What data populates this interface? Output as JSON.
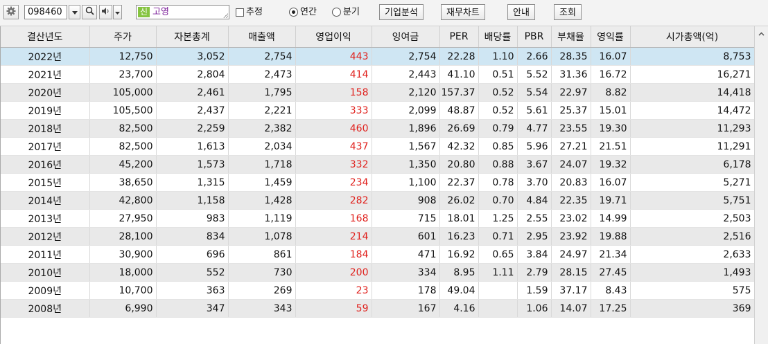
{
  "toolbar": {
    "stock_code": "098460",
    "new_badge": "신",
    "stock_name": "고영",
    "estimate_label": "추정",
    "annual_label": "연간",
    "quarter_label": "분기",
    "buttons": [
      "기업분석",
      "재무차트",
      "안내",
      "조회"
    ]
  },
  "icons": [
    "gear-icon",
    "dropdown-arrow-icon",
    "search-icon",
    "speaker-icon",
    "dropdown-arrow-icon",
    "resize-grip-icon",
    "scroll-up-icon"
  ],
  "colors": {
    "operating_profit": "#e0201c",
    "selected_row": "#cfe6f3",
    "stripe_row": "#e9e9e9",
    "new_badge": "#86c440",
    "stock_name": "#7a1c98"
  },
  "table": {
    "columns": [
      "결산년도",
      "주가",
      "자본총계",
      "매출액",
      "영업이익",
      "잉여금",
      "PER",
      "배당률",
      "PBR",
      "부채율",
      "영익률",
      "시가총액(억)"
    ],
    "rows": [
      [
        "2022년",
        "12,750",
        "3,052",
        "2,754",
        "443",
        "2,754",
        "22.28",
        "1.10",
        "2.66",
        "28.35",
        "16.07",
        "8,753"
      ],
      [
        "2021년",
        "23,700",
        "2,804",
        "2,473",
        "414",
        "2,443",
        "41.10",
        "0.51",
        "5.52",
        "31.36",
        "16.72",
        "16,271"
      ],
      [
        "2020년",
        "105,000",
        "2,461",
        "1,795",
        "158",
        "2,120",
        "157.37",
        "0.52",
        "5.54",
        "22.97",
        "8.82",
        "14,418"
      ],
      [
        "2019년",
        "105,500",
        "2,437",
        "2,221",
        "333",
        "2,099",
        "48.87",
        "0.52",
        "5.61",
        "25.37",
        "15.01",
        "14,472"
      ],
      [
        "2018년",
        "82,500",
        "2,259",
        "2,382",
        "460",
        "1,896",
        "26.69",
        "0.79",
        "4.77",
        "23.55",
        "19.30",
        "11,293"
      ],
      [
        "2017년",
        "82,500",
        "1,613",
        "2,034",
        "437",
        "1,567",
        "42.32",
        "0.85",
        "5.96",
        "27.21",
        "21.51",
        "11,291"
      ],
      [
        "2016년",
        "45,200",
        "1,573",
        "1,718",
        "332",
        "1,350",
        "20.80",
        "0.88",
        "3.67",
        "24.07",
        "19.32",
        "6,178"
      ],
      [
        "2015년",
        "38,650",
        "1,315",
        "1,459",
        "234",
        "1,100",
        "22.37",
        "0.78",
        "3.70",
        "20.83",
        "16.07",
        "5,271"
      ],
      [
        "2014년",
        "42,800",
        "1,158",
        "1,428",
        "282",
        "908",
        "26.02",
        "0.70",
        "4.84",
        "22.35",
        "19.71",
        "5,751"
      ],
      [
        "2013년",
        "27,950",
        "983",
        "1,119",
        "168",
        "715",
        "18.01",
        "1.25",
        "2.55",
        "23.02",
        "14.99",
        "2,503"
      ],
      [
        "2012년",
        "28,100",
        "834",
        "1,078",
        "214",
        "601",
        "16.23",
        "0.71",
        "2.95",
        "23.92",
        "19.88",
        "2,516"
      ],
      [
        "2011년",
        "30,900",
        "696",
        "861",
        "184",
        "471",
        "16.92",
        "0.65",
        "3.84",
        "24.97",
        "21.34",
        "2,633"
      ],
      [
        "2010년",
        "18,000",
        "552",
        "730",
        "200",
        "334",
        "8.95",
        "1.11",
        "2.79",
        "28.15",
        "27.45",
        "1,493"
      ],
      [
        "2009년",
        "10,700",
        "363",
        "269",
        "23",
        "178",
        "49.04",
        "",
        "1.59",
        "37.17",
        "8.43",
        "575"
      ],
      [
        "2008년",
        "6,990",
        "347",
        "343",
        "59",
        "167",
        "4.16",
        "",
        "1.06",
        "14.07",
        "17.25",
        "369"
      ]
    ]
  }
}
